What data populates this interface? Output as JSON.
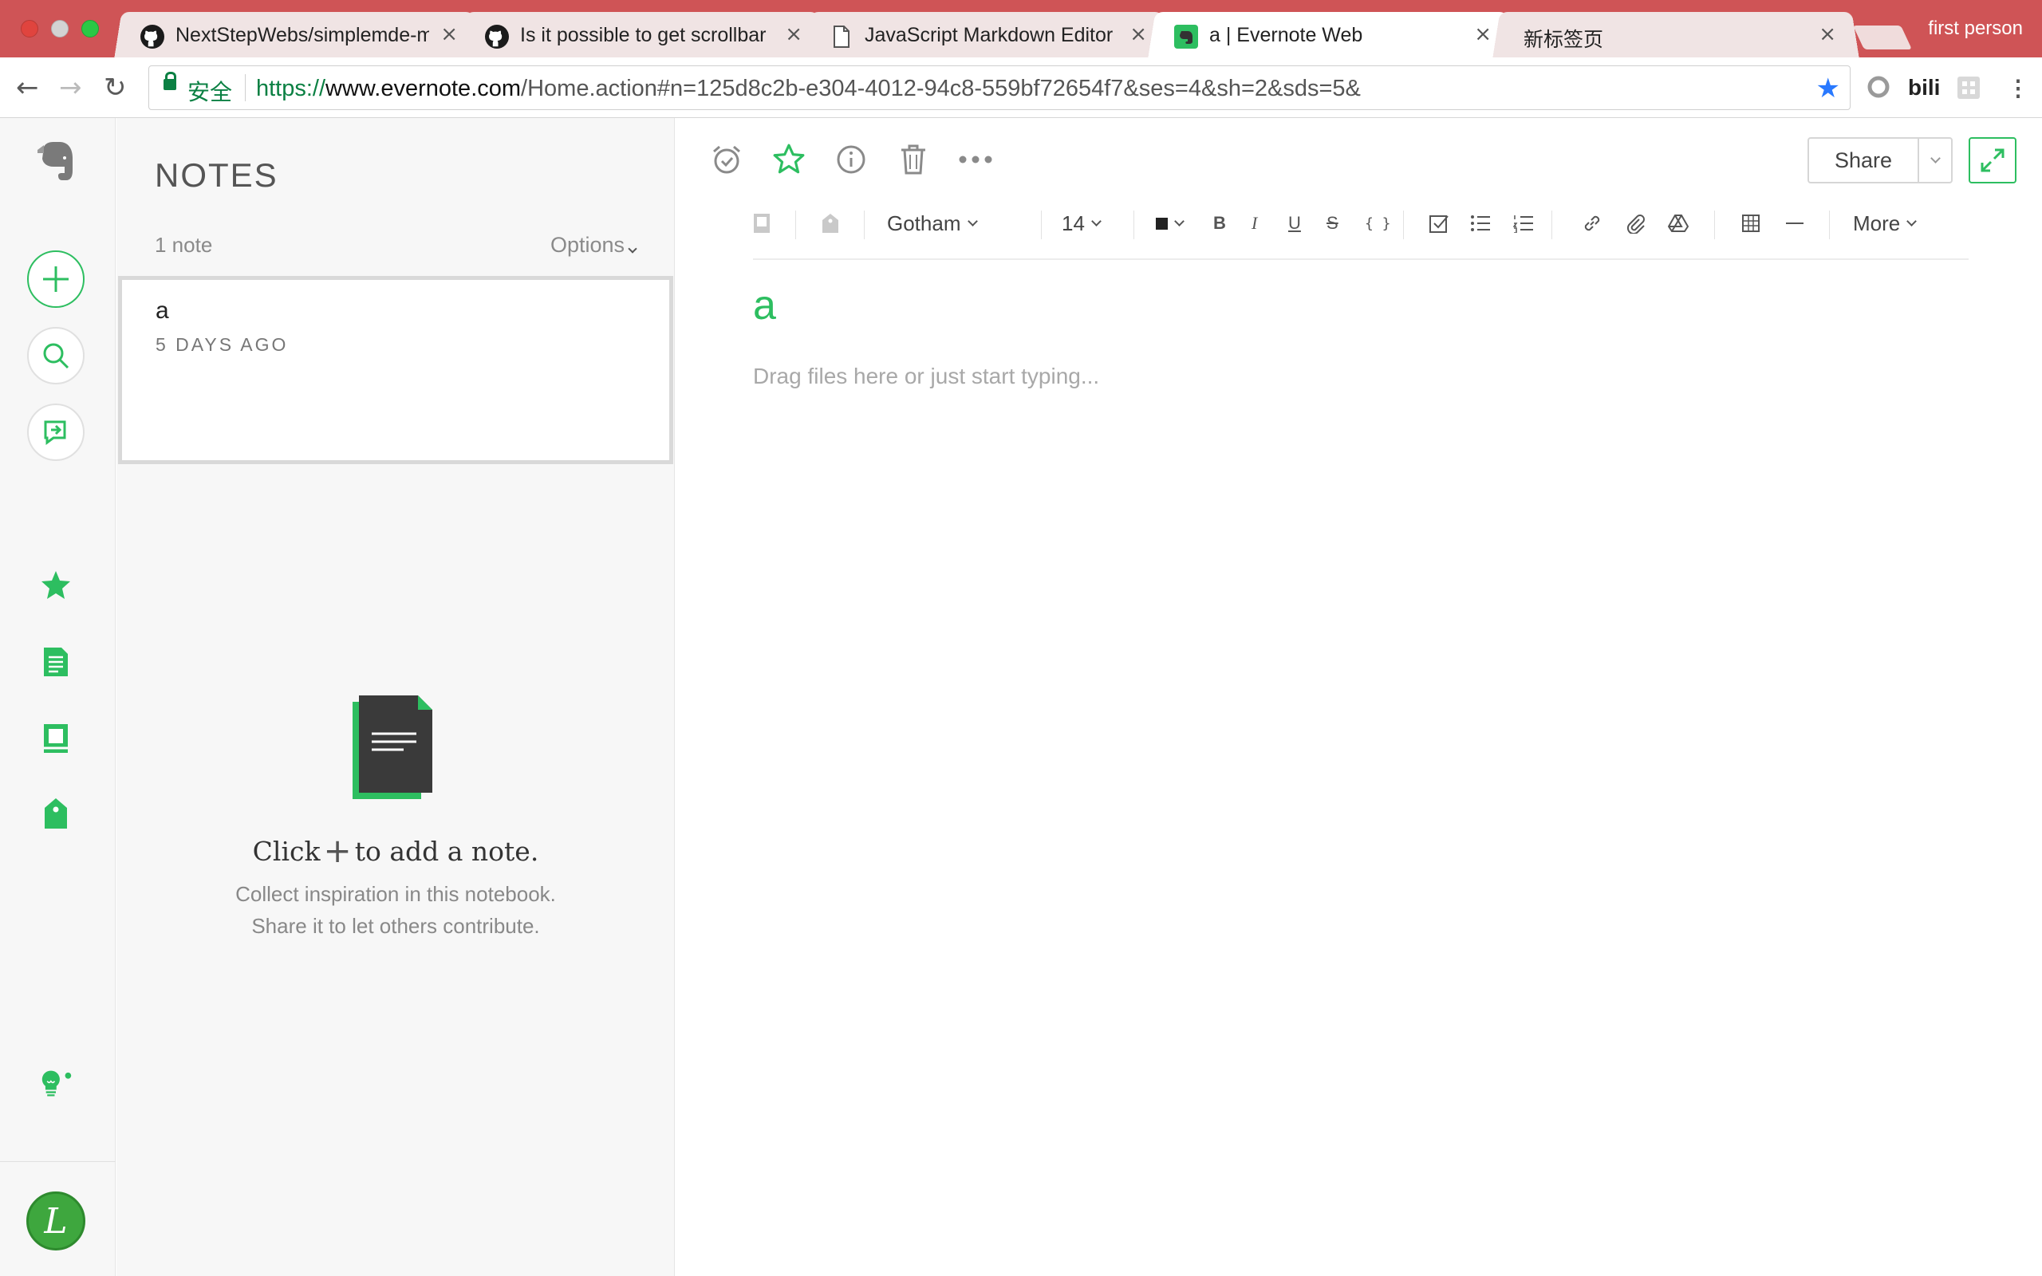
{
  "browser": {
    "tabs": [
      {
        "title": "NextStepWebs/simplemde-m",
        "favicon": "github-icon",
        "active": false
      },
      {
        "title": "Is it possible to get scrollbar",
        "favicon": "github-icon",
        "active": false
      },
      {
        "title": "JavaScript Markdown Editor",
        "favicon": "page-icon",
        "active": false
      },
      {
        "title": "a | Evernote Web",
        "favicon": "evernote-icon",
        "active": true
      },
      {
        "title": "新标签页",
        "favicon": "",
        "active": false
      }
    ],
    "profile_label": "first person",
    "secure_label": "安全",
    "url": {
      "scheme": "https://",
      "host": "www.evernote.com",
      "path": "/Home.action#n=125d8c2b-e304-4012-94c8-559bf72654f7&ses=4&sh=2&sds=5&"
    },
    "extension_label": "bili"
  },
  "sidebar": {
    "buttons": [
      "new-note",
      "search",
      "work-chat"
    ],
    "nav_icons": [
      "shortcuts-star",
      "notes",
      "notebooks",
      "tags"
    ],
    "avatar_letter": "L",
    "accent": "#2dbe60"
  },
  "notelist": {
    "title": "NOTES",
    "count_label": "1 note",
    "options_label": "Options",
    "notes": [
      {
        "title": "a",
        "date": "5 DAYS AGO"
      }
    ],
    "empty": {
      "click_prefix": "Click",
      "plus": "+",
      "click_suffix": "to add a note.",
      "line1": "Collect inspiration in this notebook.",
      "line2": "Share it to let others contribute."
    }
  },
  "editor": {
    "share_label": "Share",
    "toolbar": {
      "font": "Gotham",
      "size": "14",
      "more_label": "More"
    },
    "note_title": "a",
    "placeholder": "Drag files here or just start typing..."
  }
}
